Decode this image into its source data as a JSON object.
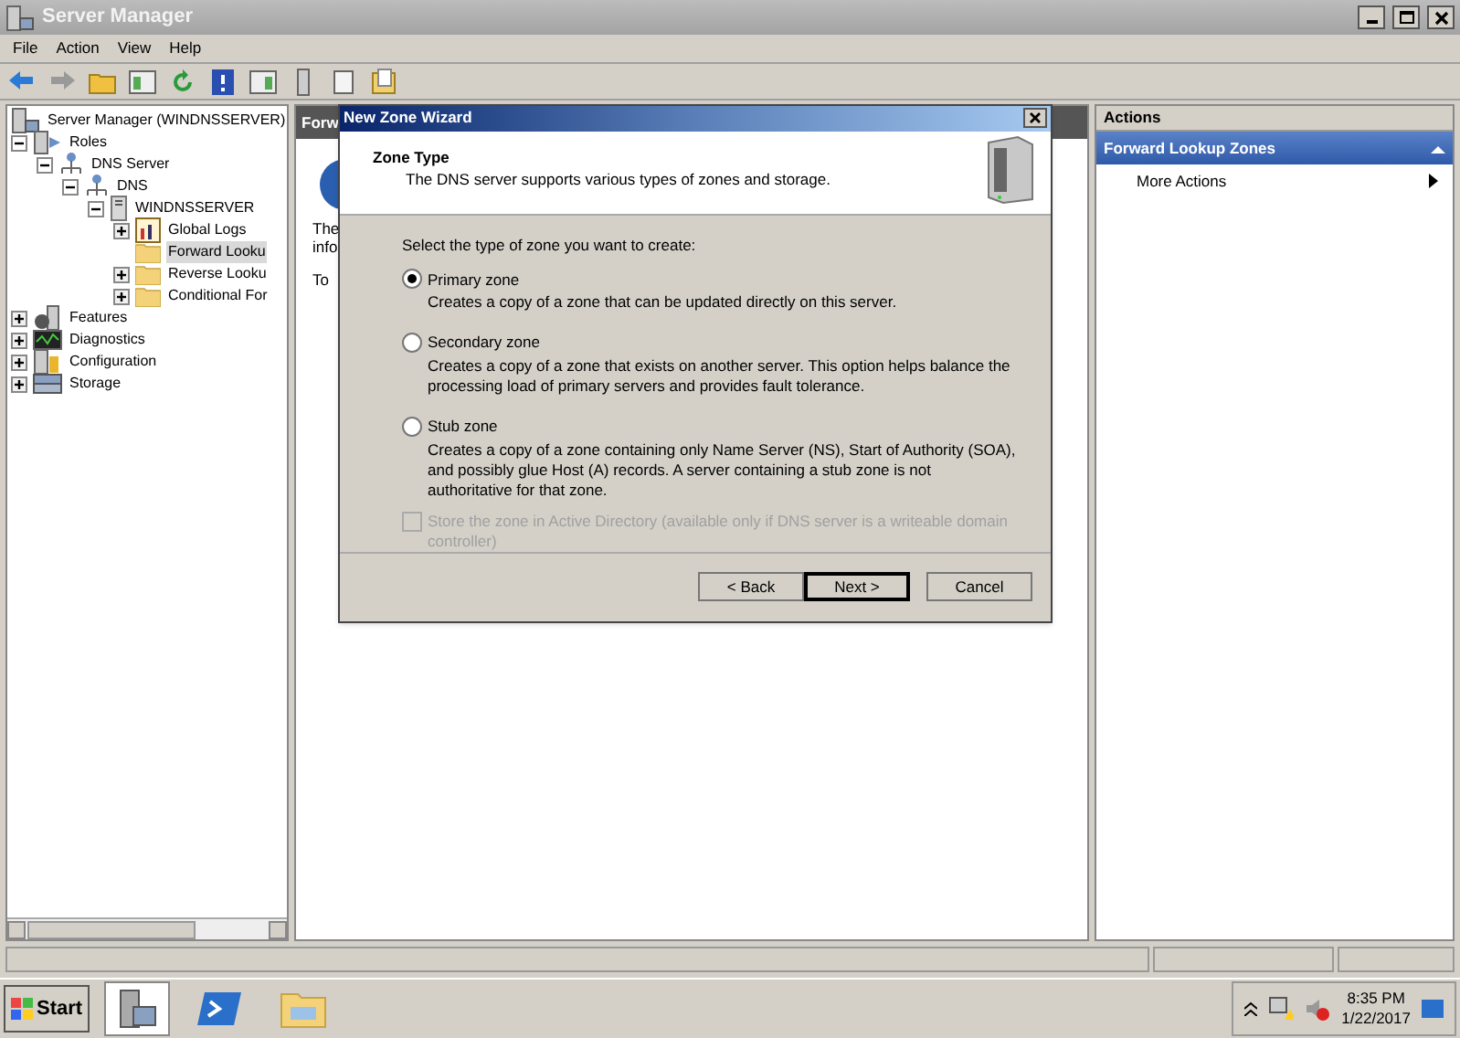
{
  "window": {
    "title": "Server Manager"
  },
  "menu": [
    "File",
    "Action",
    "View",
    "Help"
  ],
  "tree": [
    {
      "label": "Server Manager (WINDNSSERVER)",
      "kind": "root",
      "expanded": true,
      "selected": false,
      "children": [
        {
          "label": "Roles",
          "kind": "branch",
          "expanded": true,
          "selected": false,
          "children": [
            {
              "label": "DNS Server",
              "kind": "branch",
              "expanded": true,
              "selected": false,
              "children": [
                {
                  "label": "DNS",
                  "kind": "branch",
                  "expanded": true,
                  "selected": false,
                  "children": [
                    {
                      "label": "WINDNSSERVER",
                      "kind": "branch",
                      "expanded": true,
                      "selected": false,
                      "children": [
                        {
                          "label": "Global Logs",
                          "kind": "branch",
                          "expanded": false,
                          "selected": false
                        },
                        {
                          "label": "Forward Looku",
                          "kind": "leaf",
                          "selected": true
                        },
                        {
                          "label": "Reverse Looku",
                          "kind": "branch",
                          "expanded": false,
                          "selected": false
                        },
                        {
                          "label": "Conditional For",
                          "kind": "branch",
                          "expanded": false,
                          "selected": false
                        }
                      ]
                    }
                  ]
                }
              ]
            }
          ]
        },
        {
          "label": "Features",
          "kind": "branch",
          "expanded": false,
          "selected": false
        },
        {
          "label": "Diagnostics",
          "kind": "branch",
          "expanded": false,
          "selected": false
        },
        {
          "label": "Configuration",
          "kind": "branch",
          "expanded": false,
          "selected": false
        },
        {
          "label": "Storage",
          "kind": "branch",
          "expanded": false,
          "selected": false
        }
      ]
    }
  ],
  "middle": {
    "header": "Forw",
    "lines": [
      "The",
      "info",
      "To"
    ]
  },
  "wizard": {
    "title": "New Zone Wizard",
    "heading": "Zone Type",
    "subheading": "The DNS server supports various types of zones and storage.",
    "prompt": "Select the type of zone you want to create:",
    "options": [
      {
        "label": "Primary zone",
        "description": "Creates a copy of a zone that can be updated directly on this server.",
        "selected": true
      },
      {
        "label": "Secondary zone",
        "description": "Creates a copy of a zone that exists on another server. This option helps balance the processing load of primary servers and provides fault tolerance.",
        "selected": false
      },
      {
        "label": "Stub zone",
        "description": "Creates a copy of a zone containing only Name Server (NS), Start of Authority (SOA), and possibly glue Host (A) records. A server containing a stub zone is not authoritative for that zone.",
        "selected": false
      }
    ],
    "checkbox": {
      "label": "Store the zone in Active Directory (available only if DNS server is a writeable domain controller)",
      "checked": false,
      "disabled": true
    },
    "buttons": [
      {
        "label": "< Back",
        "default": false
      },
      {
        "label": "Next >",
        "default": true
      },
      {
        "label": "Cancel",
        "default": false
      }
    ]
  },
  "actions": {
    "title": "Actions",
    "section": "Forward Lookup Zones",
    "items": [
      "More Actions"
    ]
  },
  "taskbar": {
    "start": "Start",
    "time": "8:35 PM",
    "date": "1/22/2017"
  }
}
